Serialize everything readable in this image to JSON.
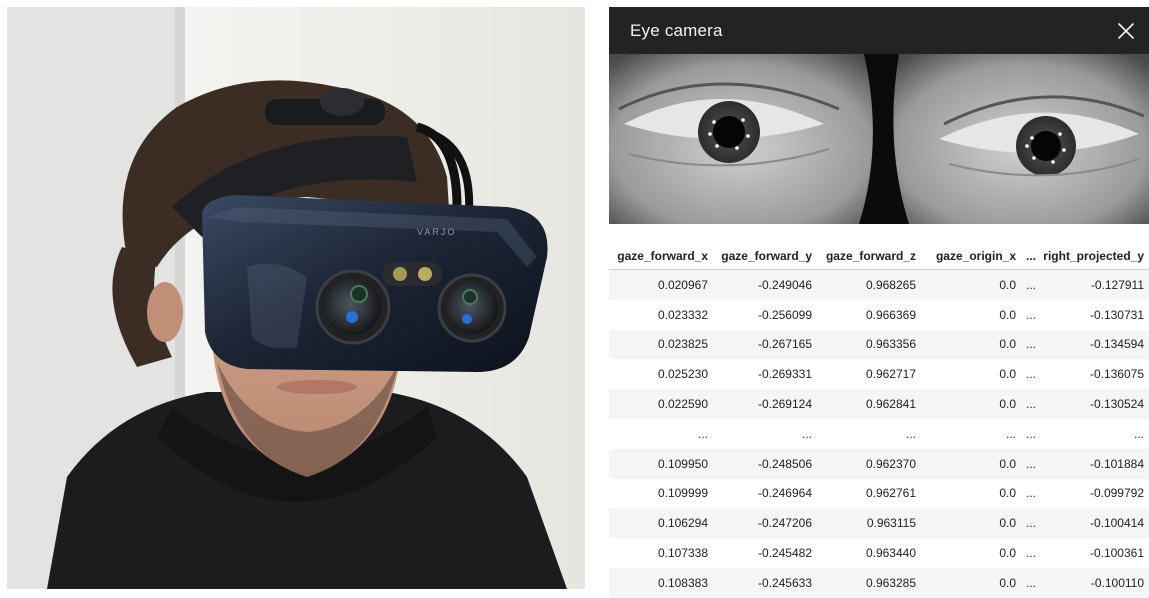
{
  "photo": {
    "headset_brand": "VARJO"
  },
  "eye_camera": {
    "title": "Eye camera",
    "close_icon": "close-icon"
  },
  "table": {
    "columns": [
      "gaze_forward_x",
      "gaze_forward_y",
      "gaze_forward_z",
      "gaze_origin_x",
      "...",
      "right_projected_y"
    ],
    "rows": [
      [
        "0.020967",
        "-0.249046",
        "0.968265",
        "0.0",
        "...",
        "-0.127911"
      ],
      [
        "0.023332",
        "-0.256099",
        "0.966369",
        "0.0",
        "...",
        "-0.130731"
      ],
      [
        "0.023825",
        "-0.267165",
        "0.963356",
        "0.0",
        "...",
        "-0.134594"
      ],
      [
        "0.025230",
        "-0.269331",
        "0.962717",
        "0.0",
        "...",
        "-0.136075"
      ],
      [
        "0.022590",
        "-0.269124",
        "0.962841",
        "0.0",
        "...",
        "-0.130524"
      ],
      [
        "...",
        "...",
        "...",
        "...",
        "...",
        "..."
      ],
      [
        "0.109950",
        "-0.248506",
        "0.962370",
        "0.0",
        "...",
        "-0.101884"
      ],
      [
        "0.109999",
        "-0.246964",
        "0.962761",
        "0.0",
        "...",
        "-0.099792"
      ],
      [
        "0.106294",
        "-0.247206",
        "0.963115",
        "0.0",
        "...",
        "-0.100414"
      ],
      [
        "0.107338",
        "-0.245482",
        "0.963440",
        "0.0",
        "...",
        "-0.100361"
      ],
      [
        "0.108383",
        "-0.245633",
        "0.963285",
        "0.0",
        "...",
        "-0.100110"
      ]
    ]
  }
}
